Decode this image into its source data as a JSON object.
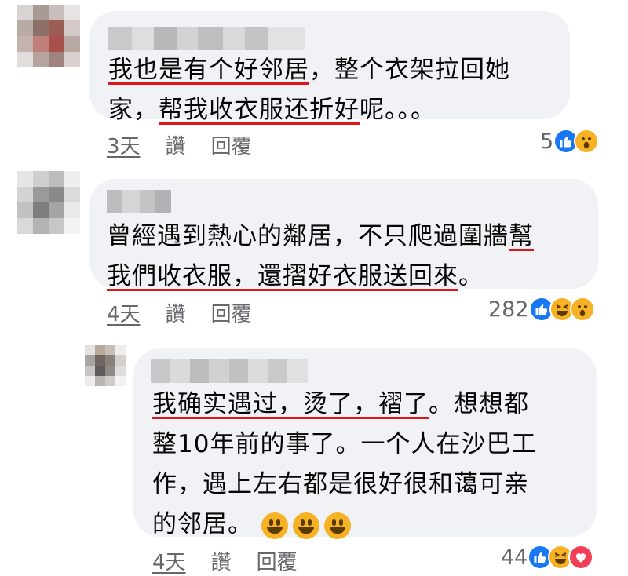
{
  "comments": [
    {
      "lines": [
        [
          {
            "t": "我也是有个好邻居",
            "u": true
          },
          {
            "t": "，整个衣架拉回她",
            "u": false
          }
        ],
        [
          {
            "t": "家，",
            "u": false
          },
          {
            "t": "帮我收衣服还折好",
            "u": true
          },
          {
            "t": "呢。。。",
            "u": false
          }
        ]
      ],
      "time": "3天",
      "like_label": "讚",
      "reply_label": "回覆",
      "reaction_count": "5",
      "reactions": [
        "like-icon",
        "wow-icon"
      ]
    },
    {
      "lines": [
        [
          {
            "t": "曾經遇到熱心的鄰居，不只爬過圍牆",
            "u": false
          },
          {
            "t": "幫",
            "u": true
          }
        ],
        [
          {
            "t": "我們收衣服，還摺好衣服送回來",
            "u": true
          },
          {
            "t": "。",
            "u": false
          }
        ]
      ],
      "time": "4天",
      "like_label": "讚",
      "reply_label": "回覆",
      "reaction_count": "282",
      "reactions": [
        "like-icon",
        "haha-icon",
        "wow-icon"
      ]
    },
    {
      "lines": [
        [
          {
            "t": "我确实遇过，烫了，褶了",
            "u": true
          },
          {
            "t": "。想想都",
            "u": false
          }
        ],
        [
          {
            "t": "整10年前的事了。一个人在沙巴工",
            "u": false
          }
        ],
        [
          {
            "t": "作，遇上左右都是很好很和蔼可亲",
            "u": false
          }
        ],
        [
          {
            "t": "的邻居。",
            "u": false
          }
        ]
      ],
      "time": "4天",
      "like_label": "讚",
      "reply_label": "回覆",
      "reaction_count": "44",
      "reactions": [
        "like-icon",
        "haha-icon",
        "love-icon"
      ]
    }
  ],
  "colors": {
    "bubble": "#f0f2f5",
    "underline": "#e0151b",
    "meta_text": "#65676b",
    "like": "#1877f2",
    "haha_wow": "#f7b125",
    "love": "#f33e58"
  }
}
